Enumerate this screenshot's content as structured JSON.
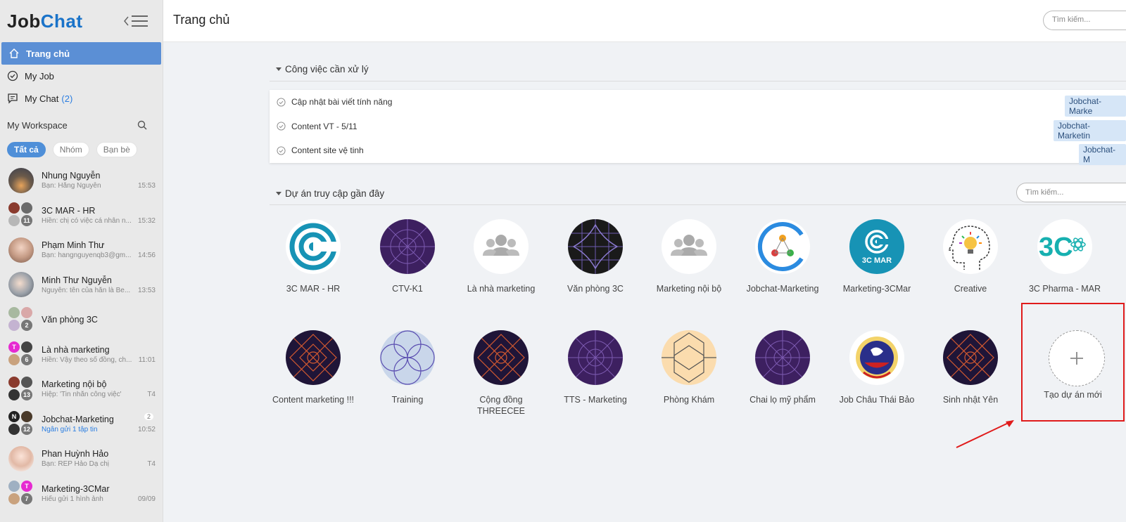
{
  "app": {
    "logo_job": "Job",
    "logo_chat": "Chat"
  },
  "nav": [
    {
      "label": "Trang chủ",
      "icon": "home-icon",
      "active": true
    },
    {
      "label": "My Job",
      "icon": "check-circle-icon"
    },
    {
      "label": "My Chat",
      "count": "(2)",
      "icon": "chat-icon"
    }
  ],
  "workspace": {
    "title": "My Workspace",
    "filters": [
      "Tất cả",
      "Nhóm",
      "Bạn bè"
    ]
  },
  "chats": [
    {
      "name": "Nhung Nguyễn",
      "sub": "Bạn: Hằng Nguyễn",
      "time": "15:53"
    },
    {
      "name": "3C MAR - HR",
      "sub": "Hiền: chị có việc cá nhân n...",
      "time": "15:32",
      "group_count": "11"
    },
    {
      "name": "Phạm Minh Thư",
      "sub": "Bạn: hangnguyenqb3@gm...",
      "time": "14:56"
    },
    {
      "name": "Minh Thư Nguyễn",
      "sub": "Nguyễn: tên của hắn là Be...",
      "time": "13:53"
    },
    {
      "name": "Văn phòng 3C",
      "sub": "",
      "time": "",
      "group_count": "2"
    },
    {
      "name": "Là nhà marketing",
      "sub": "Hiền: Vậy theo sổ đồng, ch...",
      "time": "11:01",
      "group_count": "6"
    },
    {
      "name": "Marketing nội bộ",
      "sub": "Hiệp: 'Tin nhắn công việc'",
      "time": "T4",
      "group_count": "13"
    },
    {
      "name": "Jobchat-Marketing",
      "sub": "Ngân gửi 1 tập tin",
      "time": "10:52",
      "group_count": "12",
      "badge": "2"
    },
    {
      "name": "Phan Huỳnh Hảo",
      "sub": "Bạn: REP Hảo Dạ chị",
      "time": "T4"
    },
    {
      "name": "Marketing-3CMar",
      "sub": "Hiếu gửi 1 hình ảnh",
      "time": "09/09",
      "group_count": "7"
    }
  ],
  "header": {
    "title": "Trang chủ",
    "search_placeholder": "Tìm kiếm..."
  },
  "tasks": {
    "heading": "Công việc cần xử lý",
    "items": [
      {
        "title": "Cập nhật bài viết tính năng",
        "tag": "Jobchat-Marke"
      },
      {
        "title": "Content VT - 5/11",
        "tag": "Jobchat-Marketin"
      },
      {
        "title": "Content site vệ tinh",
        "tag": "Jobchat-M"
      }
    ]
  },
  "projects": {
    "heading": "Dự án truy cập gần đây",
    "search_placeholder": "Tìm kiếm...",
    "row1": [
      "3C MAR - HR",
      "CTV-K1",
      "Là nhà marketing",
      "Văn phòng 3C",
      "Marketing nội bộ",
      "Jobchat-Marketing",
      "Marketing-3CMar",
      "Creative",
      "3C Pharma - MAR"
    ],
    "row2": [
      "Content marketing !!!",
      "Training",
      "Cộng đồng THREECEE",
      "TTS - Marketing",
      "Phòng Khám",
      "Chai lọ mỹ phẩm",
      "Job Châu Thái Bảo",
      "Sinh nhật Yên"
    ],
    "new_label": "Tạo dự án mới",
    "logo_3cmar_text": "3C MAR",
    "logo_3c_text": "3C"
  },
  "colors": {
    "accent": "#1a73c9",
    "nav_active": "#5b8fd5",
    "highlight": "#e01b1b",
    "purple": "#3d2060"
  }
}
